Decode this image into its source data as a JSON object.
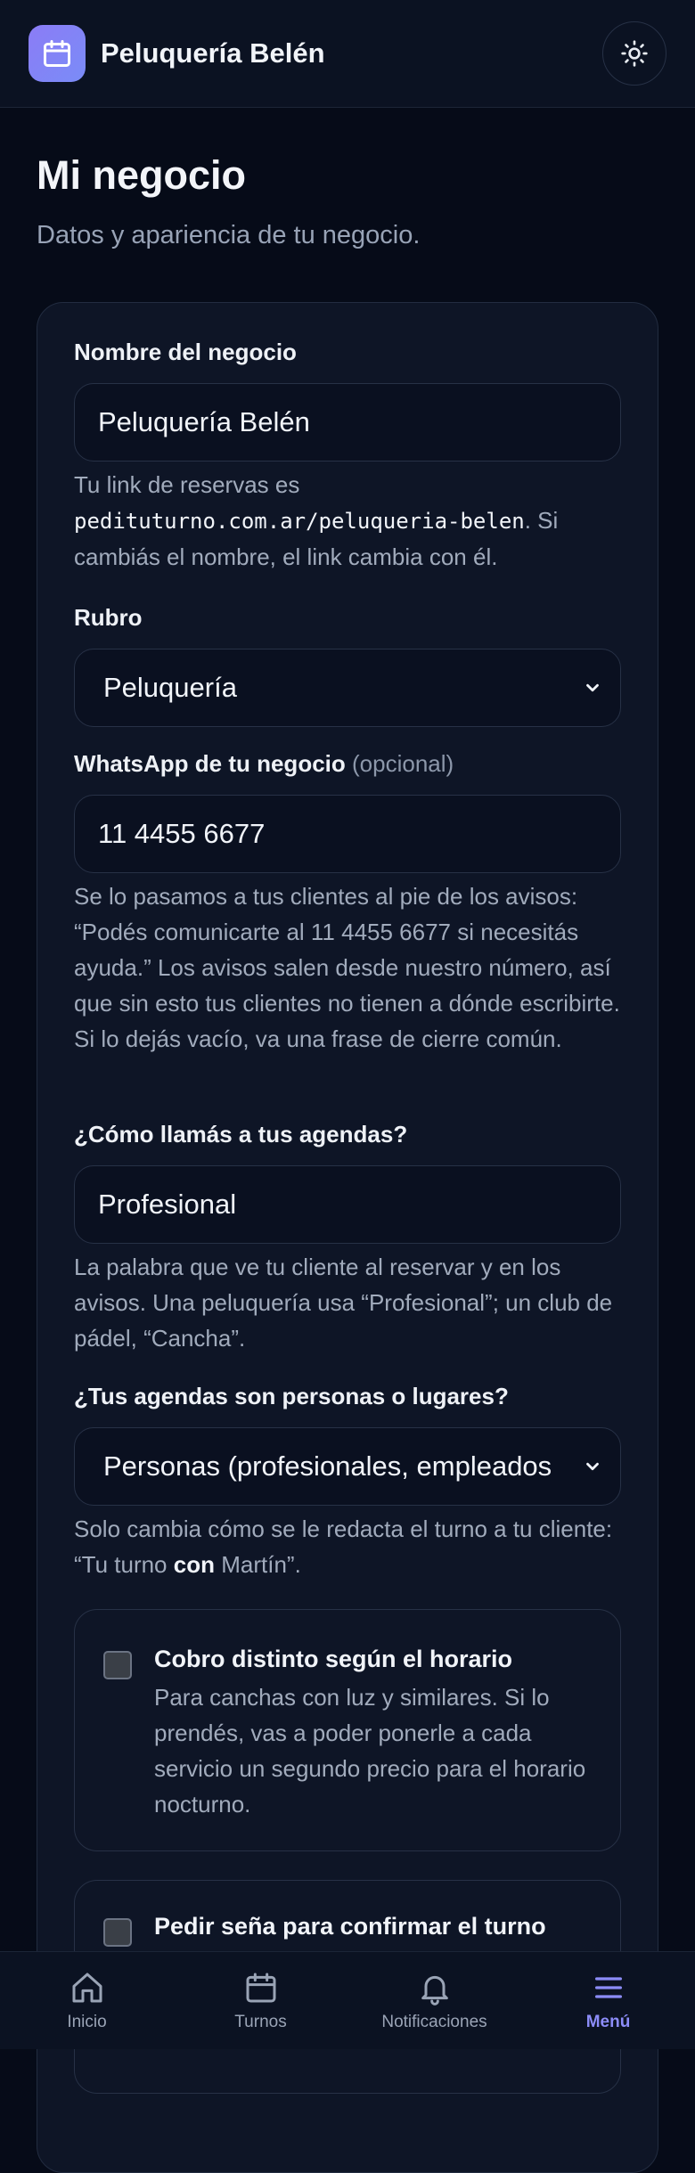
{
  "header": {
    "brand": "Peluquería Belén",
    "theme_toggle_icon": "sun-icon",
    "logo_icon": "calendar-icon"
  },
  "page": {
    "title": "Mi negocio",
    "subtitle": "Datos y apariencia de tu negocio."
  },
  "form": {
    "name_label": "Nombre del negocio",
    "name_value": "Peluquería Belén",
    "link_help_prefix": "Tu link de reservas es",
    "link_url": "pedituturno.com.ar/peluqueria-belen",
    "link_help_suffix": ". Si cambiás el nombre, el link cambia con él.",
    "rubro_label": "Rubro",
    "rubro_value": "Peluquería",
    "whatsapp_label": "WhatsApp de tu negocio",
    "whatsapp_optional": "(opcional)",
    "whatsapp_value": "11 4455 6677",
    "whatsapp_help": "Se lo pasamos a tus clientes al pie de los avisos: “Podés comunicarte al 11 4455 6677 si necesitás ayuda.” Los avisos salen desde nuestro número, así que sin esto tus clientes no tienen a dónde escribirte. Si lo dejás vacío, va una frase de cierre común.",
    "agendas_label": "¿Cómo llamás a tus agendas?",
    "agendas_value": "Profesional",
    "agendas_help": "La palabra que ve tu cliente al reservar y en los avisos. Una peluquería usa “Profesional”; un club de pádel, “Cancha”.",
    "tipo_label": "¿Tus agendas son personas o lugares?",
    "tipo_value": "Personas (profesionales, empleados",
    "tipo_help_prefix": "Solo cambia cómo se le redacta el turno a tu cliente: “Tu turno",
    "tipo_help_bold": "con",
    "tipo_help_suffix": "Martín”.",
    "option1_title": "Cobro distinto según el horario",
    "option1_desc": "Para canchas con luz y similares. Si lo prendés, vas a poder ponerle a cada servicio un segundo precio para el horario nocturno.",
    "option1_checked": false,
    "option2_title": "Pedir seña para confirmar el turno",
    "option2_checked": false
  },
  "bottom_nav": [
    {
      "label": "Inicio",
      "icon": "home-icon"
    },
    {
      "label": "Turnos",
      "icon": "calendar-icon"
    },
    {
      "label": "Notificaciones",
      "icon": "bell-icon"
    },
    {
      "label": "Menú",
      "icon": "menu-icon",
      "active": true
    }
  ],
  "colors": {
    "accent": "#8c8cf8",
    "background": "#060b18",
    "card": "#0e1526"
  }
}
